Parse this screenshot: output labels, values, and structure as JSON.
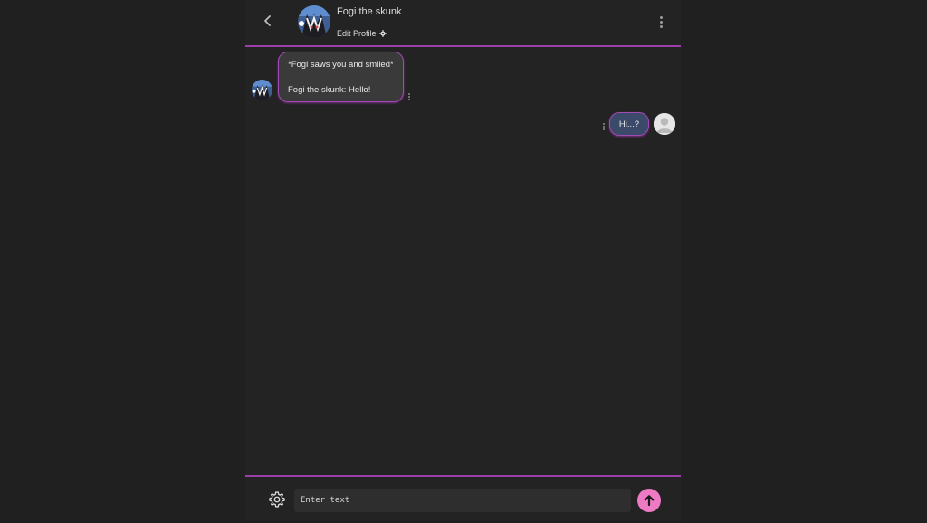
{
  "header": {
    "character_name": "Fogi the skunk",
    "edit_profile_label": "Edit Profile",
    "back_icon": "chevron-left-icon",
    "menu_icon": "more-vertical-icon",
    "edit_icon": "gear-icon"
  },
  "messages": [
    {
      "sender": "bot",
      "line1": "*Fogi saws you and smiled*",
      "line2": "Fogi the skunk: Hello!"
    },
    {
      "sender": "user",
      "text": "Hi...?"
    }
  ],
  "composer": {
    "placeholder": "Enter text",
    "settings_icon": "gear-icon",
    "send_icon": "arrow-up-icon"
  },
  "colors": {
    "background": "#202020",
    "accent": "#9b3fa8",
    "bot_bubble": "#3a3a3a",
    "user_bubble": "#3c4a6a",
    "send_button": "#ef7ac4"
  }
}
